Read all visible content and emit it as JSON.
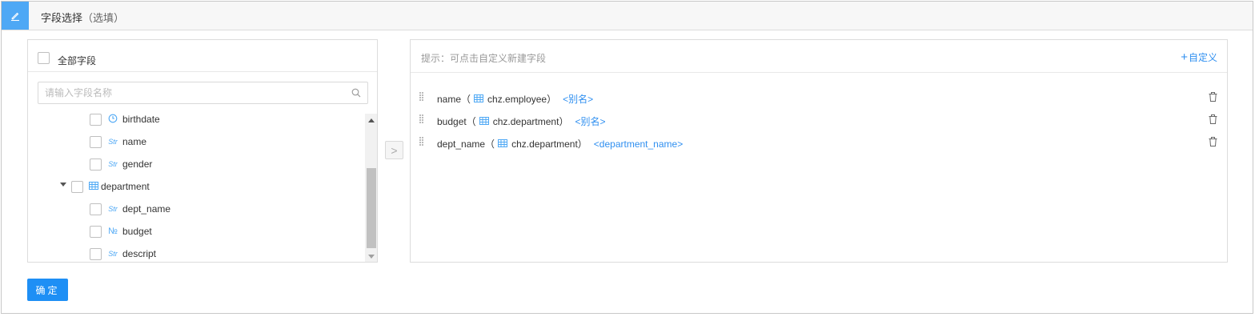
{
  "header": {
    "title": "字段选择",
    "optional": "（选填）"
  },
  "left": {
    "select_all_label": "全部字段",
    "search_placeholder": "请输入字段名称",
    "tree": [
      {
        "label": "birthdate",
        "type_icon": "clock-icon"
      },
      {
        "label": "name",
        "type_icon": "Str"
      },
      {
        "label": "gender",
        "type_icon": "Str"
      },
      {
        "label": "department",
        "type_icon": "table-icon",
        "expanded": true
      },
      {
        "label": "dept_name",
        "type_icon": "Str"
      },
      {
        "label": "budget",
        "type_icon": "№"
      },
      {
        "label": "descript",
        "type_icon": "Str"
      }
    ]
  },
  "transfer_glyph": ">",
  "right": {
    "hint": "提示：可点击自定义新建字段",
    "custom_plus": "+",
    "custom_label": "自定义",
    "selected": [
      {
        "field": "name",
        "open": "（",
        "table": "chz.employee",
        "close": "）",
        "alias": "<别名>"
      },
      {
        "field": "budget",
        "open": "（",
        "table": "chz.department",
        "close": "）",
        "alias": "<别名>"
      },
      {
        "field": "dept_name",
        "open": "（",
        "table": "chz.department",
        "close": "）",
        "alias": "<department_name>"
      }
    ]
  },
  "confirm_label": "确定",
  "colors": {
    "accent": "#1e8ff5",
    "link": "#2f8ff0",
    "header_icon_bg": "#4ea8f5"
  }
}
